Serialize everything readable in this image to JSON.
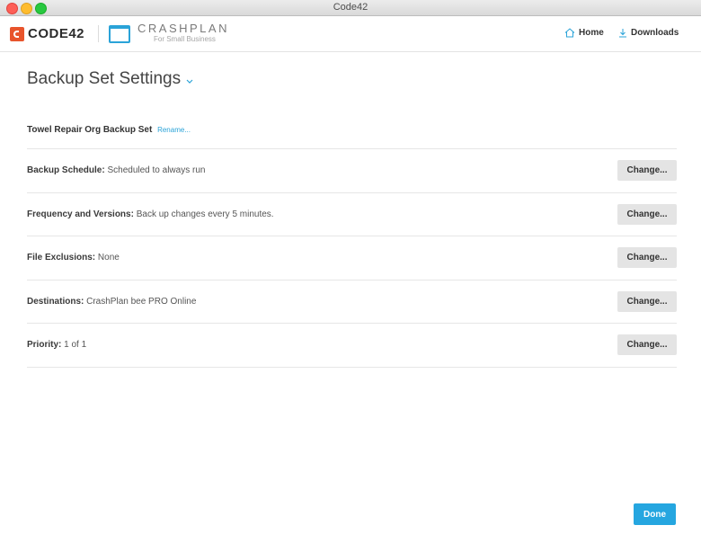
{
  "window": {
    "title": "Code42"
  },
  "header": {
    "brand": "CODE42",
    "product_name": "CRASHPLAN",
    "product_sub": "For Small Business",
    "nav": {
      "home": "Home",
      "downloads": "Downloads"
    }
  },
  "page": {
    "title": "Backup Set Settings"
  },
  "backup_set": {
    "name": "Towel Repair Org Backup Set",
    "rename_label": "Rename..."
  },
  "settings": [
    {
      "label": "Backup Schedule:",
      "value": "Scheduled to always run",
      "button": "Change..."
    },
    {
      "label": "Frequency and Versions:",
      "value": "Back up changes every 5 minutes.",
      "button": "Change..."
    },
    {
      "label": "File Exclusions:",
      "value": "None",
      "button": "Change..."
    },
    {
      "label": "Destinations:",
      "value": "CrashPlan bee PRO Online",
      "button": "Change..."
    },
    {
      "label": "Priority:",
      "value": "1 of 1",
      "button": "Change..."
    }
  ],
  "footer": {
    "done_label": "Done"
  },
  "colors": {
    "accent": "#25a6e0",
    "brand_orange": "#e8542c",
    "crashplan_blue": "#2aa3d8"
  }
}
